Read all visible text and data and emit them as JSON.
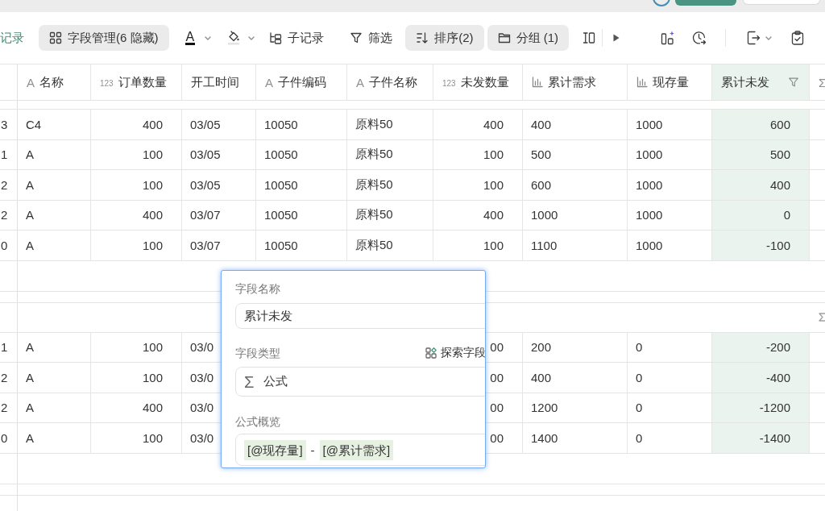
{
  "toolbar": {
    "items": [
      {
        "kind": "link",
        "label": "记录"
      },
      {
        "kind": "fields",
        "label": "字段管理(6 隐藏)",
        "active": true
      },
      {
        "kind": "text_color",
        "glyph": "A"
      },
      {
        "kind": "fill_color"
      },
      {
        "kind": "subrecord",
        "label": "子记录",
        "active": false
      },
      {
        "kind": "filter",
        "label": "筛选",
        "active": false
      },
      {
        "kind": "sort",
        "label": "排序(2)",
        "active": true
      },
      {
        "kind": "group",
        "label": "分组 (1)",
        "active": true
      },
      {
        "kind": "row_height"
      },
      {
        "kind": "expand"
      }
    ],
    "tools": [
      {
        "kind": "ai_layout"
      },
      {
        "kind": "history"
      },
      {
        "kind": "export"
      },
      {
        "kind": "task"
      }
    ]
  },
  "table": {
    "columns": [
      {
        "label": "名称",
        "kind": "text",
        "glyph": "A",
        "selected": false,
        "filtered": false
      },
      {
        "label": "订单数量",
        "kind": "number",
        "glyph": "123",
        "selected": false,
        "filtered": false
      },
      {
        "label": "开工时间",
        "kind": "date",
        "selected": false,
        "filtered": false
      },
      {
        "label": "子件编码",
        "kind": "text",
        "glyph": "A",
        "selected": false,
        "filtered": false
      },
      {
        "label": "子件名称",
        "kind": "text",
        "glyph": "A",
        "selected": false,
        "filtered": false
      },
      {
        "label": "未发数量",
        "kind": "number",
        "glyph": "123",
        "selected": false,
        "filtered": false
      },
      {
        "label": "累计需求",
        "kind": "stat",
        "selected": false,
        "filtered": false
      },
      {
        "label": "现存量",
        "kind": "stat",
        "selected": false,
        "filtered": false
      },
      {
        "label": "累计未发",
        "kind": "formula",
        "selected": true,
        "filtered": true
      },
      {
        "kind": "formula",
        "glyph": "Σ",
        "selected": false,
        "filtered": false
      }
    ],
    "groups": [
      {
        "rows": [
          {
            "column_0": "3",
            "cells": [
              "C4",
              "400",
              "03/05",
              "10050",
              "原料50",
              "400",
              "400",
              "1000",
              "600"
            ]
          },
          {
            "column_0": "1",
            "cells": [
              "A",
              "100",
              "03/05",
              "10050",
              "原料50",
              "100",
              "500",
              "1000",
              "500"
            ]
          },
          {
            "column_0": "2",
            "cells": [
              "A",
              "100",
              "03/05",
              "10050",
              "原料50",
              "100",
              "600",
              "1000",
              "400"
            ]
          },
          {
            "column_0": "2",
            "cells": [
              "A",
              "400",
              "03/07",
              "10050",
              "原料50",
              "400",
              "1000",
              "1000",
              "0"
            ]
          },
          {
            "column_0": "0",
            "cells": [
              "A",
              "100",
              "03/07",
              "10050",
              "原料50",
              "100",
              "1100",
              "1000",
              "-100"
            ]
          }
        ]
      },
      {
        "rows": [
          {
            "column_0": "1",
            "cells": [
              "A",
              "100",
              "03/0",
              null,
              null,
              "00",
              "200",
              "0",
              "-200"
            ]
          },
          {
            "column_0": "2",
            "cells": [
              "A",
              "100",
              "03/0",
              null,
              null,
              "00",
              "400",
              "0",
              "-400"
            ]
          },
          {
            "column_0": "2",
            "cells": [
              "A",
              "400",
              "03/0",
              null,
              null,
              "00",
              "1200",
              "0",
              "-1200"
            ]
          },
          {
            "column_0": "0",
            "cells": [
              "A",
              "100",
              "03/0",
              null,
              null,
              "00",
              "1400",
              "0",
              "-1400"
            ]
          }
        ]
      }
    ]
  },
  "field_editor": {
    "name_label": "字段名称",
    "name": "累计未发",
    "type_label": "字段类型",
    "explore_link": "探索字段",
    "type_glyph": "Σ",
    "type": "公式",
    "formula_label": "公式概览",
    "formula": [
      {
        "kind": "field",
        "text": "[@现存量]"
      },
      {
        "kind": "operator",
        "text": "-"
      },
      {
        "kind": "field",
        "text": "[@累计需求]"
      }
    ]
  }
}
